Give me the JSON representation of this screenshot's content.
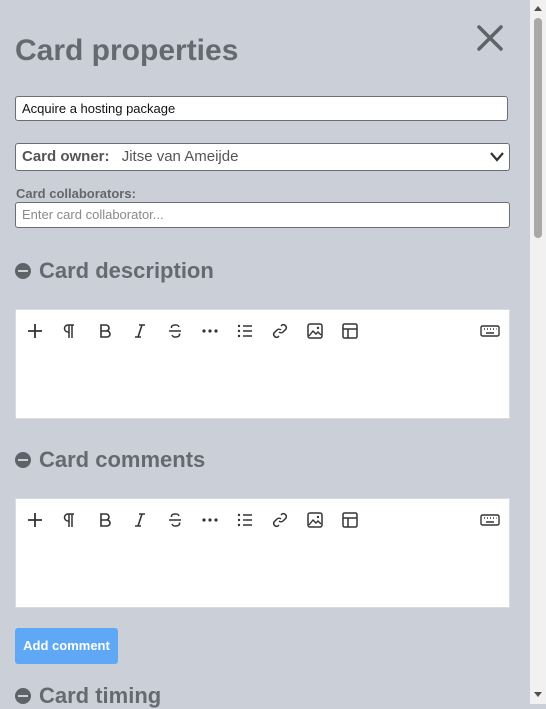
{
  "dialog": {
    "title": "Card properties",
    "card_title_value": "Acquire a hosting package",
    "owner_label": "Card owner:",
    "owner_value": "Jitse van Ameijde",
    "collaborators_label": "Card collaborators:",
    "collaborators_placeholder": "Enter card collaborator..."
  },
  "sections": {
    "description": "Card description",
    "comments": "Card comments",
    "timing": "Card timing"
  },
  "toolbar": [
    "plus-icon",
    "paragraph-icon",
    "bold-icon",
    "italic-icon",
    "strikethrough-icon",
    "more-icon",
    "list-icon",
    "link-icon",
    "image-icon",
    "table-icon",
    "keyboard-icon"
  ],
  "buttons": {
    "add_comment": "Add comment"
  },
  "colors": {
    "background": "#cbd0d8",
    "accent": "#5ea8f6"
  }
}
